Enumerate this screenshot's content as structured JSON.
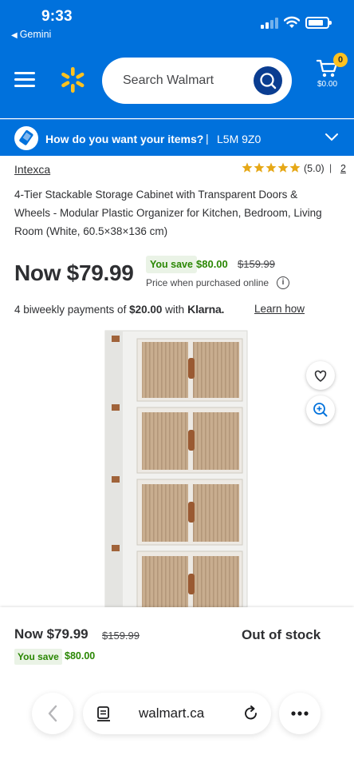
{
  "status_bar": {
    "time": "9:33",
    "back_app": "Gemini"
  },
  "header": {
    "search_placeholder": "Search Walmart",
    "cart_count": "0",
    "cart_total": "$0.00",
    "brand_color": "#0071dc",
    "accent_color": "#ffc220"
  },
  "delivery": {
    "prompt": "How do you want your items?",
    "separator": "|",
    "postal_code": "L5M 9Z0"
  },
  "product": {
    "brand": "Intexca",
    "rating": "(5.0)",
    "rating_separator": "|",
    "review_count": "2",
    "stars": 5,
    "title": "4-Tier Stackable Storage Cabinet with Transparent Doors & Wheels - Modular Plastic Organizer for Kitchen, Bedroom, Living Room (White, 60.5×38×136 cm)"
  },
  "price": {
    "now": "Now $79.99",
    "you_save_label": "You save",
    "save_amount": "$80.00",
    "was": "$159.99",
    "note": "Price when purchased online",
    "info_glyph": "i"
  },
  "klarna": {
    "prefix": "4 biweekly payments of",
    "amount": "$20.00",
    "with": "with",
    "logo": "Klarna.",
    "link": "Learn how"
  },
  "sticky": {
    "now": "Now $79.99",
    "was": "$159.99",
    "you_save_label": "You save",
    "save_amount": "$80.00",
    "stock_status": "Out of stock"
  },
  "browser": {
    "url": "walmart.ca"
  },
  "icons": {
    "menu": "menu-icon",
    "logo": "walmart-spark-icon",
    "search": "search-icon",
    "cart": "cart-icon",
    "delivery": "delivery-icon",
    "favorite": "heart-icon",
    "zoom": "zoom-icon",
    "back": "chevron-left-icon",
    "reader": "reader-icon",
    "reload": "reload-icon",
    "more": "more-icon"
  }
}
